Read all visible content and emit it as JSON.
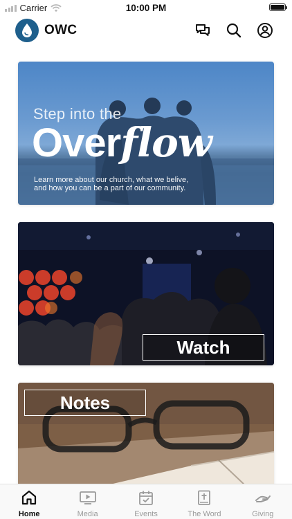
{
  "status_bar": {
    "carrier": "Carrier",
    "time": "10:00 PM"
  },
  "header": {
    "app_name": "OWC"
  },
  "cards": {
    "overflow": {
      "line1": "Step into the",
      "line2_a": "Over",
      "line2_b": "flow",
      "desc_line1": "Learn more about our church, what we belive,",
      "desc_line2": "and how you can be a part of our community."
    },
    "watch": {
      "label": "Watch"
    },
    "notes": {
      "label": "Notes"
    }
  },
  "tabs": [
    {
      "label": "Home",
      "icon": "home-icon",
      "active": true
    },
    {
      "label": "Media",
      "icon": "media-icon",
      "active": false
    },
    {
      "label": "Events",
      "icon": "calendar-icon",
      "active": false
    },
    {
      "label": "The Word",
      "icon": "bible-icon",
      "active": false
    },
    {
      "label": "Giving",
      "icon": "giving-icon",
      "active": false
    }
  ],
  "colors": {
    "brand": "#1e5f8c",
    "active_tab": "#111111",
    "inactive_tab": "#9a9a9a"
  }
}
